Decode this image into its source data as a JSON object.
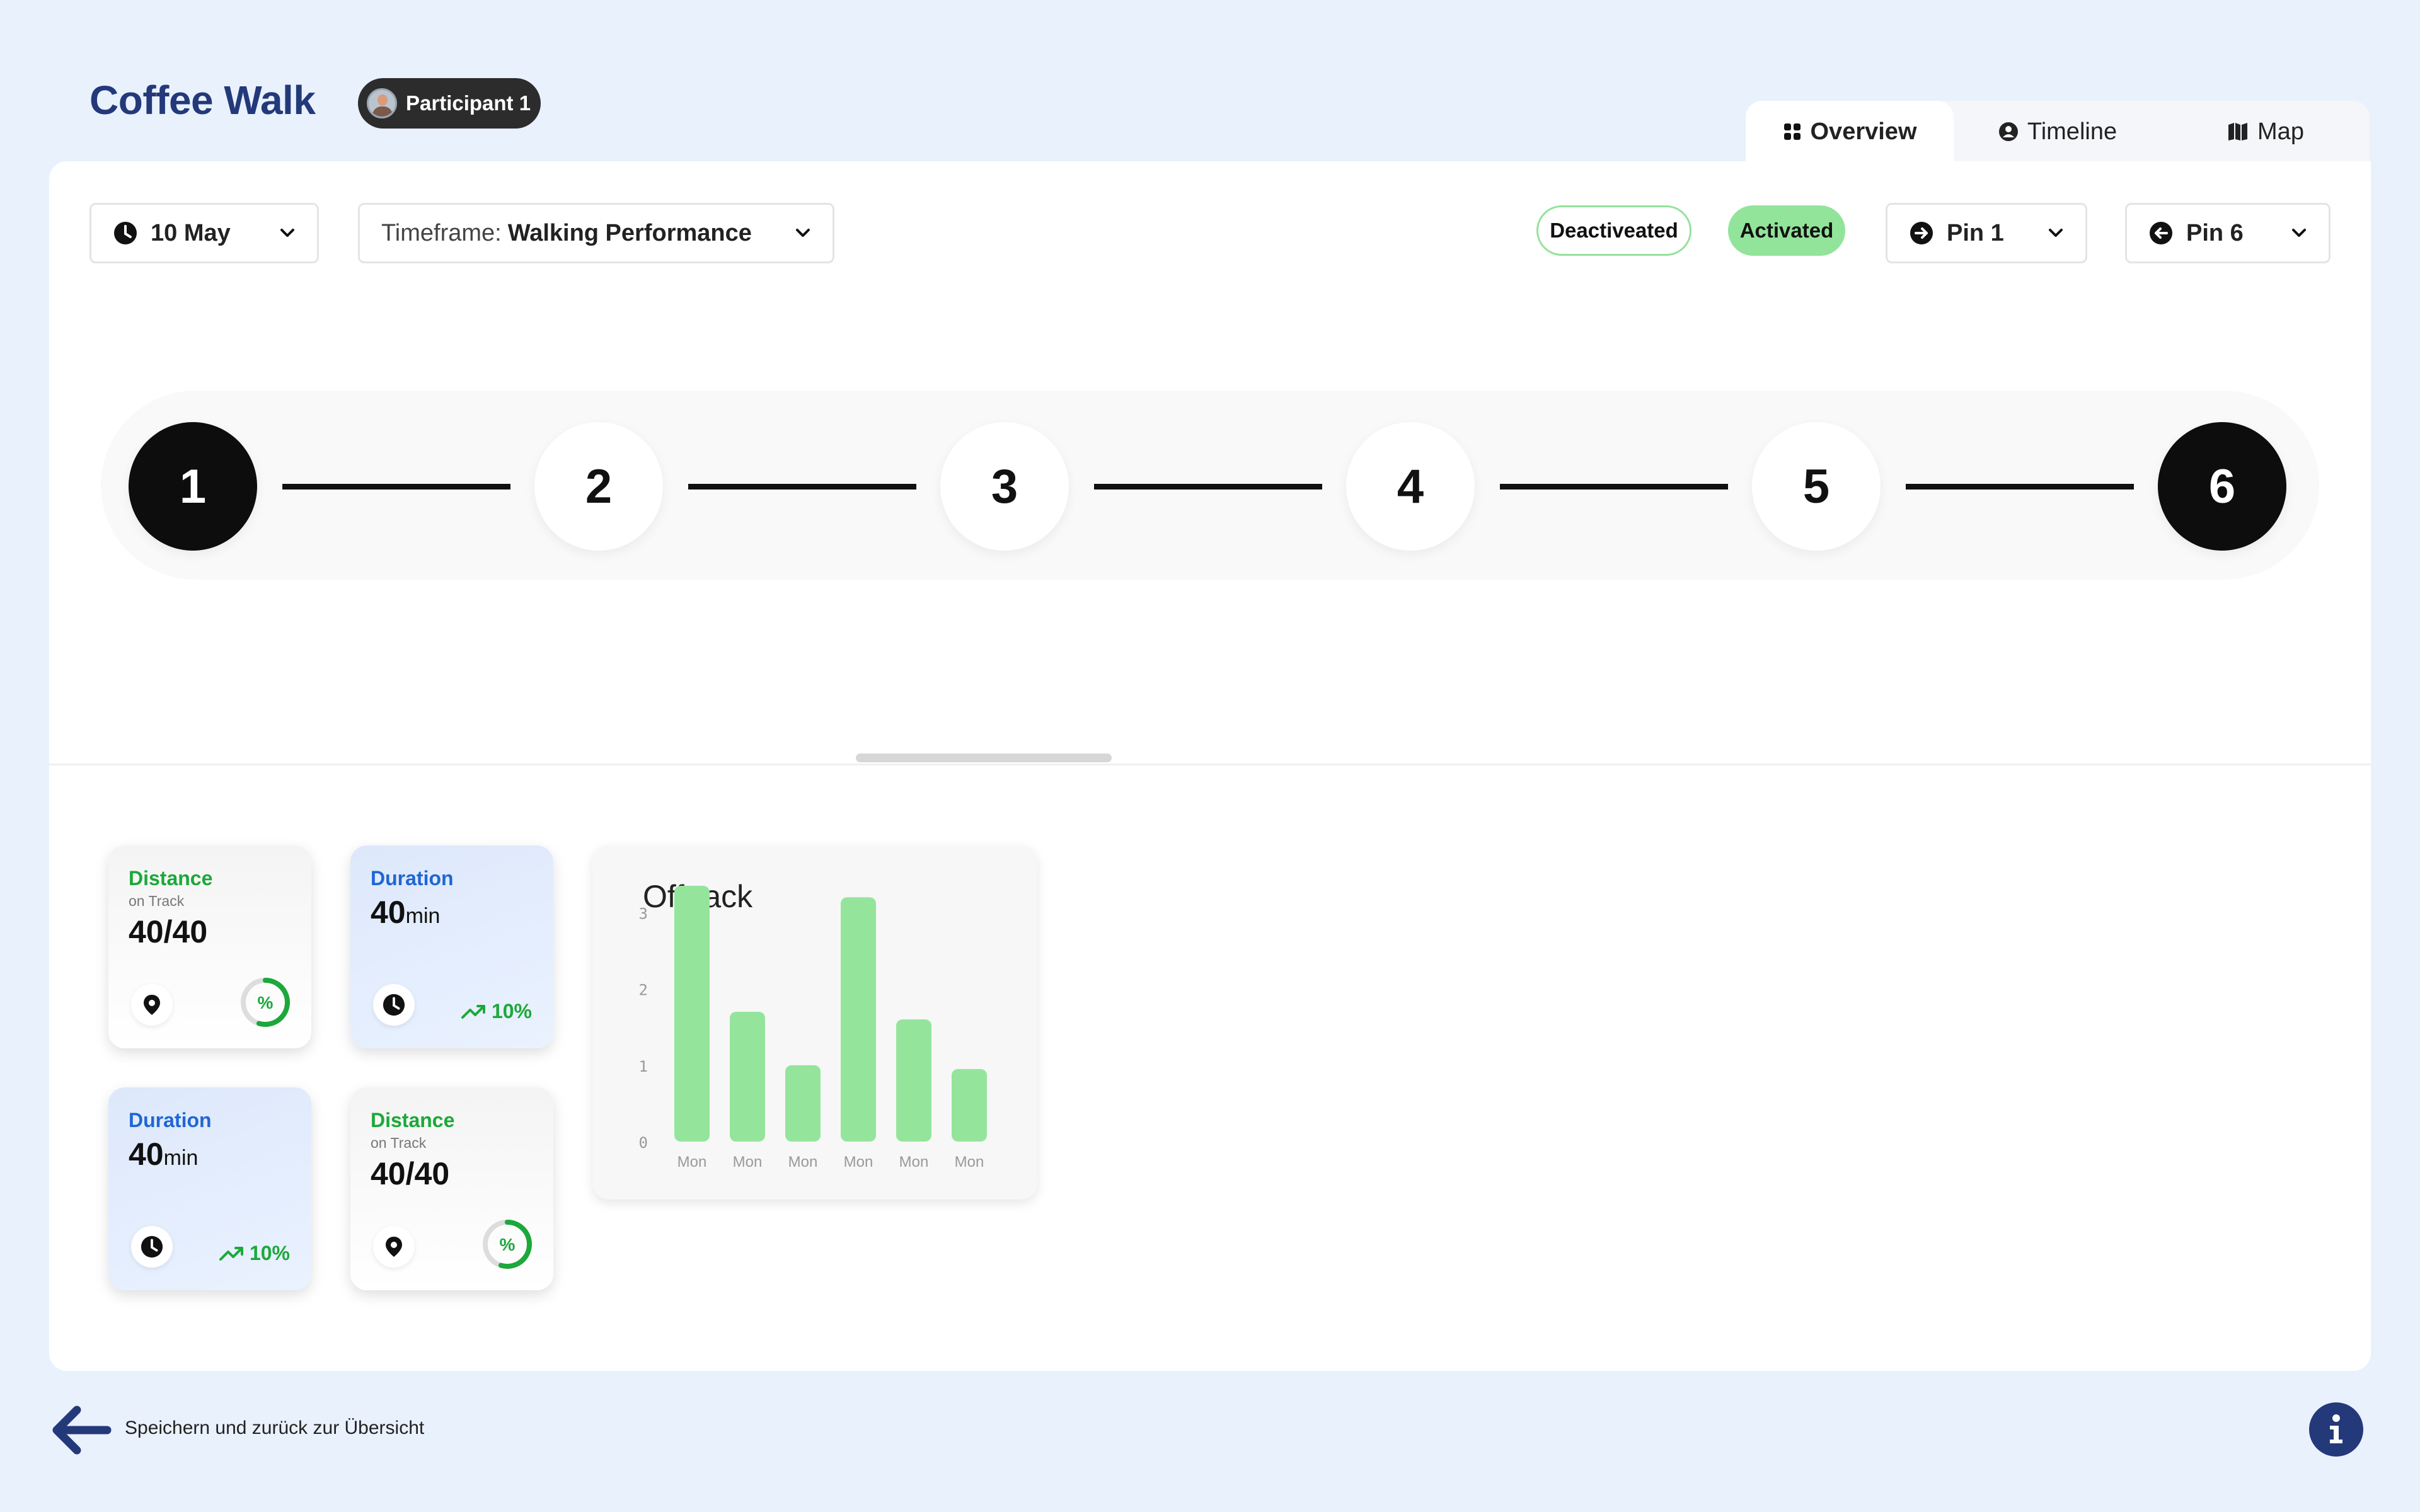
{
  "header": {
    "app_title": "Coffee Walk",
    "participant": "Participant 1"
  },
  "view_tabs": [
    {
      "label": "Overview",
      "icon": "grid-icon",
      "active": true
    },
    {
      "label": "Timeline",
      "icon": "user-circle-icon",
      "active": false
    },
    {
      "label": "Map",
      "icon": "map-icon",
      "active": false
    }
  ],
  "filters": {
    "date": "10 May",
    "timeframe_prefix": "Timeframe:",
    "timeframe_value": "Walking Performance",
    "deactivated_label": "Deactiveated",
    "activated_label": "Activated",
    "pin_start": "Pin 1",
    "pin_end": "Pin 6"
  },
  "stepper": {
    "steps": [
      "1",
      "2",
      "3",
      "4",
      "5",
      "6"
    ],
    "active_steps": [
      "1",
      "6"
    ]
  },
  "stats": {
    "card1": {
      "title": "Distance",
      "subtitle": "on Track",
      "value": "40/40",
      "ring_label": "%"
    },
    "card2": {
      "title": "Duration",
      "value": "40",
      "unit": "min",
      "trend": "10%"
    },
    "card3": {
      "title": "Duration",
      "value": "40",
      "unit": "min",
      "trend": "10%"
    },
    "card4": {
      "title": "Distance",
      "subtitle": "on Track",
      "value": "40/40",
      "ring_label": "%"
    }
  },
  "chart_data": {
    "type": "bar",
    "title": "Offtrack",
    "categories": [
      "Mon",
      "Mon",
      "Mon",
      "Mon",
      "Mon",
      "Mon"
    ],
    "values": [
      3.35,
      1.7,
      1.0,
      3.2,
      1.6,
      0.95
    ],
    "yticks": [
      "0",
      "1",
      "2",
      "3"
    ],
    "ylim": [
      0,
      3.4
    ],
    "bar_color": "#94e59b",
    "grid": false
  },
  "footer": {
    "back_label": "Speichern und zurück zur Übersicht"
  },
  "colors": {
    "brand": "#23397a",
    "green": "#1ca83a",
    "blue": "#1f66d4",
    "background": "#e9f1fd"
  }
}
